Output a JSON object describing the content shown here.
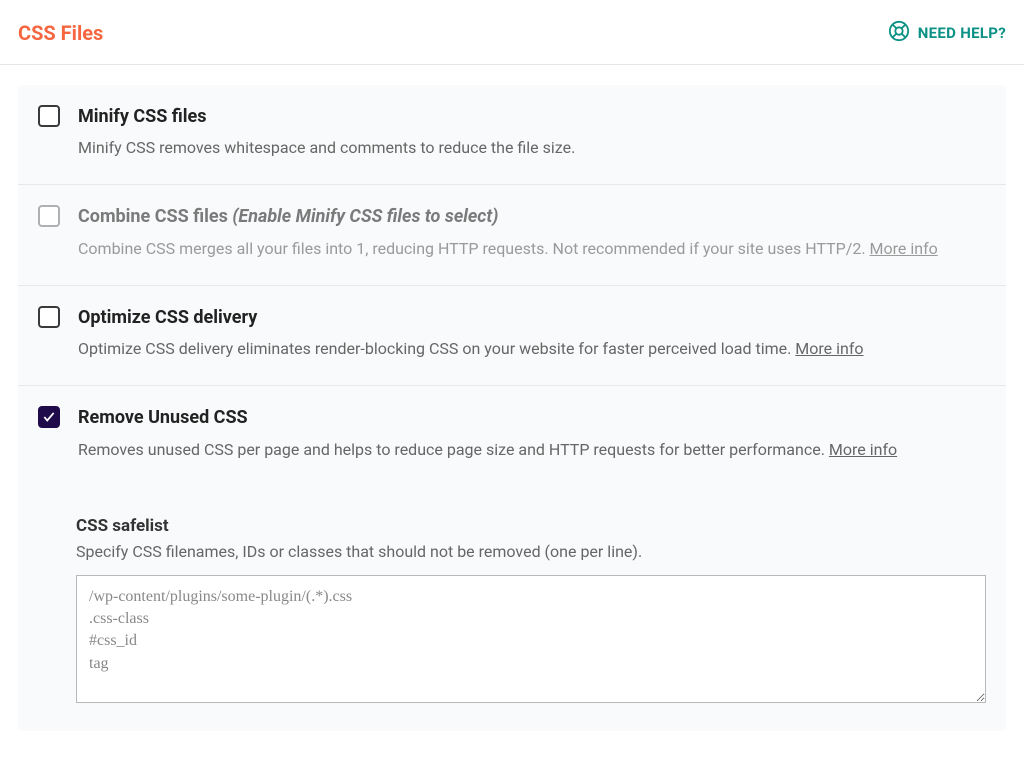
{
  "header": {
    "title": "CSS Files",
    "help_label": "NEED HELP?"
  },
  "options": {
    "minify": {
      "title": "Minify CSS files",
      "desc": "Minify CSS removes whitespace and comments to reduce the file size."
    },
    "combine": {
      "title": "Combine CSS files",
      "note": "(Enable Minify CSS files to select)",
      "desc": "Combine CSS merges all your files into 1, reducing HTTP requests. Not recommended if your site uses HTTP/2.",
      "more_info": "More info"
    },
    "optimize": {
      "title": "Optimize CSS delivery",
      "desc": "Optimize CSS delivery eliminates render-blocking CSS on your website for faster perceived load time.",
      "more_info": "More info"
    },
    "remove_unused": {
      "title": "Remove Unused CSS",
      "desc": "Removes unused CSS per page and helps to reduce page size and HTTP requests for better performance.",
      "more_info": "More info"
    }
  },
  "safelist": {
    "title": "CSS safelist",
    "desc": "Specify CSS filenames, IDs or classes that should not be removed (one per line).",
    "placeholder": "/wp-content/plugins/some-plugin/(.*).css\n.css-class\n#css_id\ntag"
  }
}
